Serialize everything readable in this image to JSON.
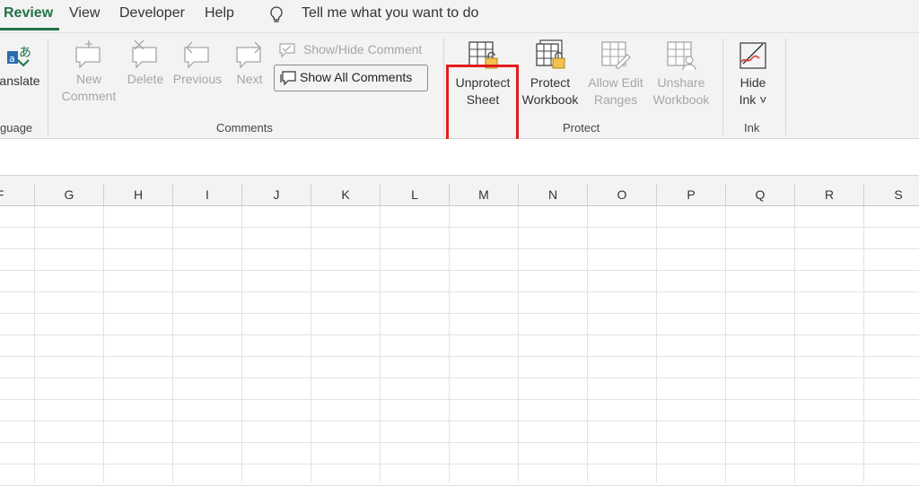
{
  "tabs": {
    "review": "Review",
    "view": "View",
    "developer": "Developer",
    "help": "Help",
    "tell_me": "Tell me what you want to do"
  },
  "ribbon": {
    "language": {
      "translate_label": "anslate",
      "group_label": "guage"
    },
    "comments": {
      "new_line1": "New",
      "new_line2": "Comment",
      "delete": "Delete",
      "previous": "Previous",
      "next": "Next",
      "show_hide": "Show/Hide Comment",
      "show_all": "Show All Comments",
      "group_label": "Comments"
    },
    "protect": {
      "unprotect_line1": "Unprotect",
      "unprotect_line2": "Sheet",
      "protect_line1": "Protect",
      "protect_line2": "Workbook",
      "allow_line1": "Allow Edit",
      "allow_line2": "Ranges",
      "unshare_line1": "Unshare",
      "unshare_line2": "Workbook",
      "group_label": "Protect"
    },
    "ink": {
      "hide_line1": "Hide",
      "hide_line2": "Ink ˅",
      "group_label": "Ink"
    }
  },
  "columns": [
    "F",
    "G",
    "H",
    "I",
    "J",
    "K",
    "L",
    "M",
    "N",
    "O",
    "P",
    "Q",
    "R",
    "S"
  ],
  "colors": {
    "accent": "#217346",
    "highlight": "#e31b1b"
  }
}
